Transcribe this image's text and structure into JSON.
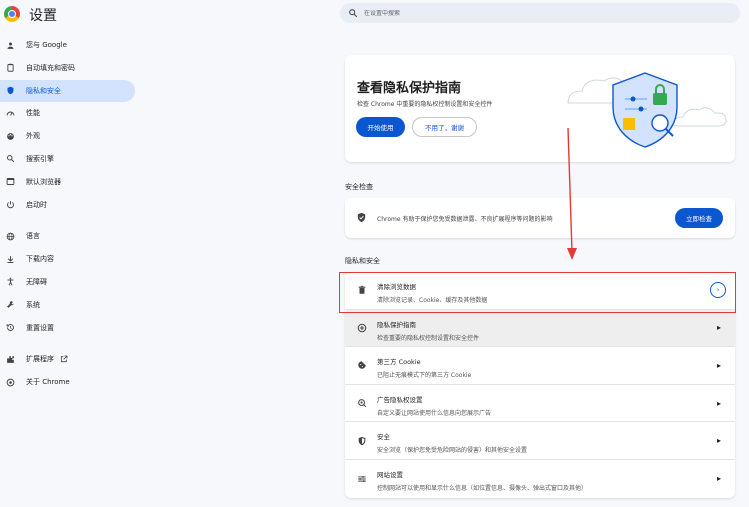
{
  "app": {
    "title": "设置"
  },
  "search": {
    "placeholder": "在设置中搜索"
  },
  "sidebar": {
    "items": [
      {
        "label": "您与 Google",
        "icon": "person-icon"
      },
      {
        "label": "自动填充和密码",
        "icon": "clipboard-icon"
      },
      {
        "label": "隐私和安全",
        "icon": "shield-icon",
        "active": true
      },
      {
        "label": "性能",
        "icon": "speedometer-icon"
      },
      {
        "label": "外观",
        "icon": "palette-icon"
      },
      {
        "label": "搜索引擎",
        "icon": "search-icon"
      },
      {
        "label": "默认浏览器",
        "icon": "browser-window-icon"
      },
      {
        "label": "启动时",
        "icon": "power-icon"
      },
      {
        "label": "语言",
        "icon": "globe-icon"
      },
      {
        "label": "下载内容",
        "icon": "download-icon"
      },
      {
        "label": "无障碍",
        "icon": "accessibility-icon"
      },
      {
        "label": "系统",
        "icon": "wrench-icon"
      },
      {
        "label": "重置设置",
        "icon": "history-icon"
      },
      {
        "label": "扩展程序",
        "icon": "puzzle-icon"
      },
      {
        "label": "关于 Chrome",
        "icon": "chrome-logo-icon"
      }
    ]
  },
  "guide_card": {
    "title": "查看隐私保护指南",
    "description": "检查 Chrome 中重要的隐私权控制设置和安全控件",
    "start_button": "开始使用",
    "dismiss_button": "不用了，谢谢"
  },
  "safety_check": {
    "section_title": "安全检查",
    "text": "Chrome 有助于保护您免受数据泄露、不良扩展程序等问题的影响",
    "button": "立即检查"
  },
  "privacy_section": {
    "section_title": "隐私和安全",
    "rows": [
      {
        "title": "清除浏览数据",
        "subtitle": "清除浏览记录、Cookie、缓存及其他数据",
        "icon": "trash-icon"
      },
      {
        "title": "隐私保护指南",
        "subtitle": "检查重要的隐私权控制设置和安全控件",
        "icon": "add-circle-icon"
      },
      {
        "title": "第三方 Cookie",
        "subtitle": "已阻止无痕模式下的第三方 Cookie",
        "icon": "cookie-icon"
      },
      {
        "title": "广告隐私权设置",
        "subtitle": "自定义要让网站使用什么信息向您展示广告",
        "icon": "ad-privacy-icon"
      },
      {
        "title": "安全",
        "subtitle": "安全浏览（保护您免受危险网站的侵害）和其他安全设置",
        "icon": "security-shield-icon"
      },
      {
        "title": "网站设置",
        "subtitle": "控制网站可以使用和显示什么信息（如位置信息、摄像头、弹出式窗口及其他）",
        "icon": "tune-icon"
      }
    ]
  },
  "colors": {
    "accent": "#0b57d0",
    "active_nav_bg": "#d3e3fd",
    "annotation_red": "#e53935",
    "background": "#f6f8fc"
  }
}
